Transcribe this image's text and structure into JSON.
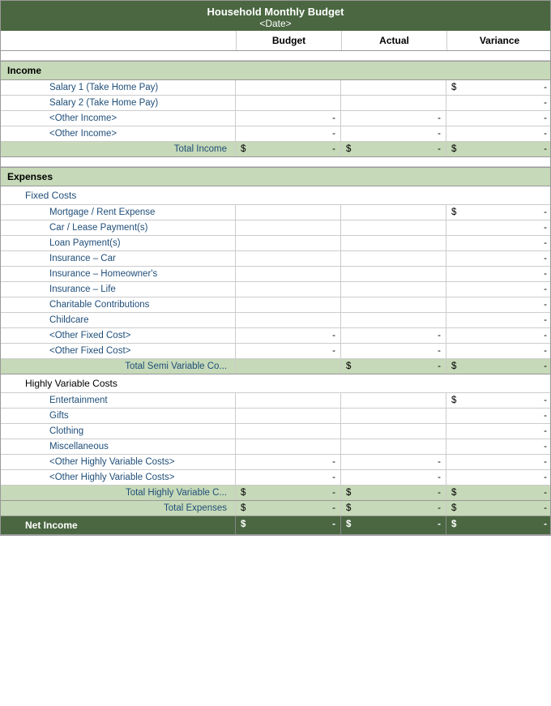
{
  "title": {
    "main": "Household Monthly Budget",
    "sub": "<Date>"
  },
  "headers": {
    "col1": "",
    "col2": "Budget",
    "col3": "Actual",
    "col4": "Variance"
  },
  "sections": {
    "income": {
      "label": "Income",
      "rows": [
        {
          "label": "Salary 1 (Take Home Pay)",
          "budget": "",
          "actual": "",
          "variance_prefix": "$",
          "variance": "-"
        },
        {
          "label": "Salary 2 (Take Home Pay)",
          "budget": "",
          "actual": "",
          "variance_prefix": "",
          "variance": "-"
        },
        {
          "label": "<Other Income>",
          "budget": "-",
          "actual": "-",
          "variance_prefix": "",
          "variance": "-"
        },
        {
          "label": "<Other Income>",
          "budget": "-",
          "actual": "-",
          "variance_prefix": "",
          "variance": "-"
        }
      ],
      "total": {
        "label": "Total Income",
        "b_prefix": "$",
        "b_val": "-",
        "a_prefix": "$",
        "a_val": "-",
        "v_prefix": "$",
        "v_val": "-"
      }
    },
    "expenses": {
      "label": "Expenses",
      "fixed": {
        "label": "Fixed Costs",
        "rows": [
          {
            "label": "Mortgage / Rent Expense",
            "budget": "",
            "actual": "",
            "v_prefix": "$",
            "variance": "-"
          },
          {
            "label": "Car / Lease Payment(s)",
            "budget": "",
            "actual": "",
            "v_prefix": "",
            "variance": "-"
          },
          {
            "label": "Loan Payment(s)",
            "budget": "",
            "actual": "",
            "v_prefix": "",
            "variance": "-"
          },
          {
            "label": "Insurance – Car",
            "budget": "",
            "actual": "",
            "v_prefix": "",
            "variance": "-"
          },
          {
            "label": "Insurance – Homeowner's",
            "budget": "",
            "actual": "",
            "v_prefix": "",
            "variance": "-"
          },
          {
            "label": "Insurance – Life",
            "budget": "",
            "actual": "",
            "v_prefix": "",
            "variance": "-"
          },
          {
            "label": "Charitable Contributions",
            "budget": "",
            "actual": "",
            "v_prefix": "",
            "variance": "-"
          },
          {
            "label": "Childcare",
            "budget": "",
            "actual": "",
            "v_prefix": "",
            "variance": "-"
          },
          {
            "label": "<Other Fixed Cost>",
            "budget": "-",
            "actual": "-",
            "v_prefix": "",
            "variance": "-"
          },
          {
            "label": "<Other Fixed Cost>",
            "budget": "-",
            "actual": "-",
            "v_prefix": "",
            "variance": "-"
          }
        ],
        "total": {
          "label": "Total Semi Variable Co...",
          "b_prefix": "",
          "b_val": "",
          "a_prefix": "$",
          "a_val": "-",
          "v_prefix": "$",
          "v_val": "-"
        }
      },
      "variable": {
        "label": "Highly Variable Costs",
        "rows": [
          {
            "label": "Entertainment",
            "budget": "",
            "actual": "",
            "v_prefix": "$",
            "variance": "-"
          },
          {
            "label": "Gifts",
            "budget": "",
            "actual": "",
            "v_prefix": "",
            "variance": "-"
          },
          {
            "label": "Clothing",
            "budget": "",
            "actual": "",
            "v_prefix": "",
            "variance": "-"
          },
          {
            "label": "Miscellaneous",
            "budget": "",
            "actual": "",
            "v_prefix": "",
            "variance": "-"
          },
          {
            "label": "<Other Highly Variable Costs>",
            "budget": "-",
            "actual": "-",
            "v_prefix": "",
            "variance": "-"
          },
          {
            "label": "<Other Highly Variable Costs>",
            "budget": "-",
            "actual": "-",
            "v_prefix": "",
            "variance": "-"
          }
        ],
        "total_hv": {
          "label": "Total Highly Variable C...",
          "b_prefix": "$",
          "b_val": "-",
          "a_prefix": "$",
          "a_val": "-",
          "v_prefix": "$",
          "v_val": "-"
        },
        "total_exp": {
          "label": "Total Expenses",
          "b_prefix": "$",
          "b_val": "-",
          "a_prefix": "$",
          "a_val": "-",
          "v_prefix": "$",
          "v_val": "-"
        }
      }
    },
    "net_income": {
      "label": "Net Income",
      "b_prefix": "$",
      "b_val": "-",
      "a_prefix": "$",
      "a_val": "-",
      "v_prefix": "$",
      "v_val": "-"
    }
  }
}
